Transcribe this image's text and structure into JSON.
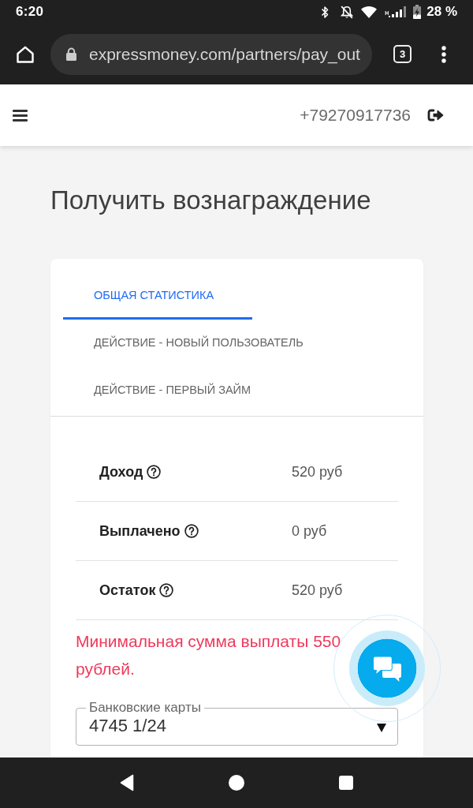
{
  "status_bar": {
    "time": "6:20",
    "network_type": "H",
    "battery": "28 %"
  },
  "browser": {
    "url": "expressmoney.com/partners/pay_out",
    "tab_count": "3"
  },
  "header": {
    "phone": "+79270917736"
  },
  "title": "Получить вознаграждение",
  "tabs": [
    {
      "label": "ОБЩАЯ СТАТИСТИКА",
      "selected": true
    },
    {
      "label": "ДЕЙСТВИЕ - НОВЫЙ ПОЛЬЗОВАТЕЛЬ",
      "selected": false
    },
    {
      "label": "ДЕЙСТВИЕ - ПЕРВЫЙ ЗАЙМ",
      "selected": false
    }
  ],
  "stats": [
    {
      "label": "Доход",
      "value": "520 руб"
    },
    {
      "label": "Выплачено",
      "value": "0 руб"
    },
    {
      "label": "Остаток",
      "value": "520 руб"
    }
  ],
  "error_message": "Минимальная сумма выплаты 550 рублей.",
  "bank_card_select": {
    "label": "Банковские карты",
    "value": "4745 1/24"
  }
}
